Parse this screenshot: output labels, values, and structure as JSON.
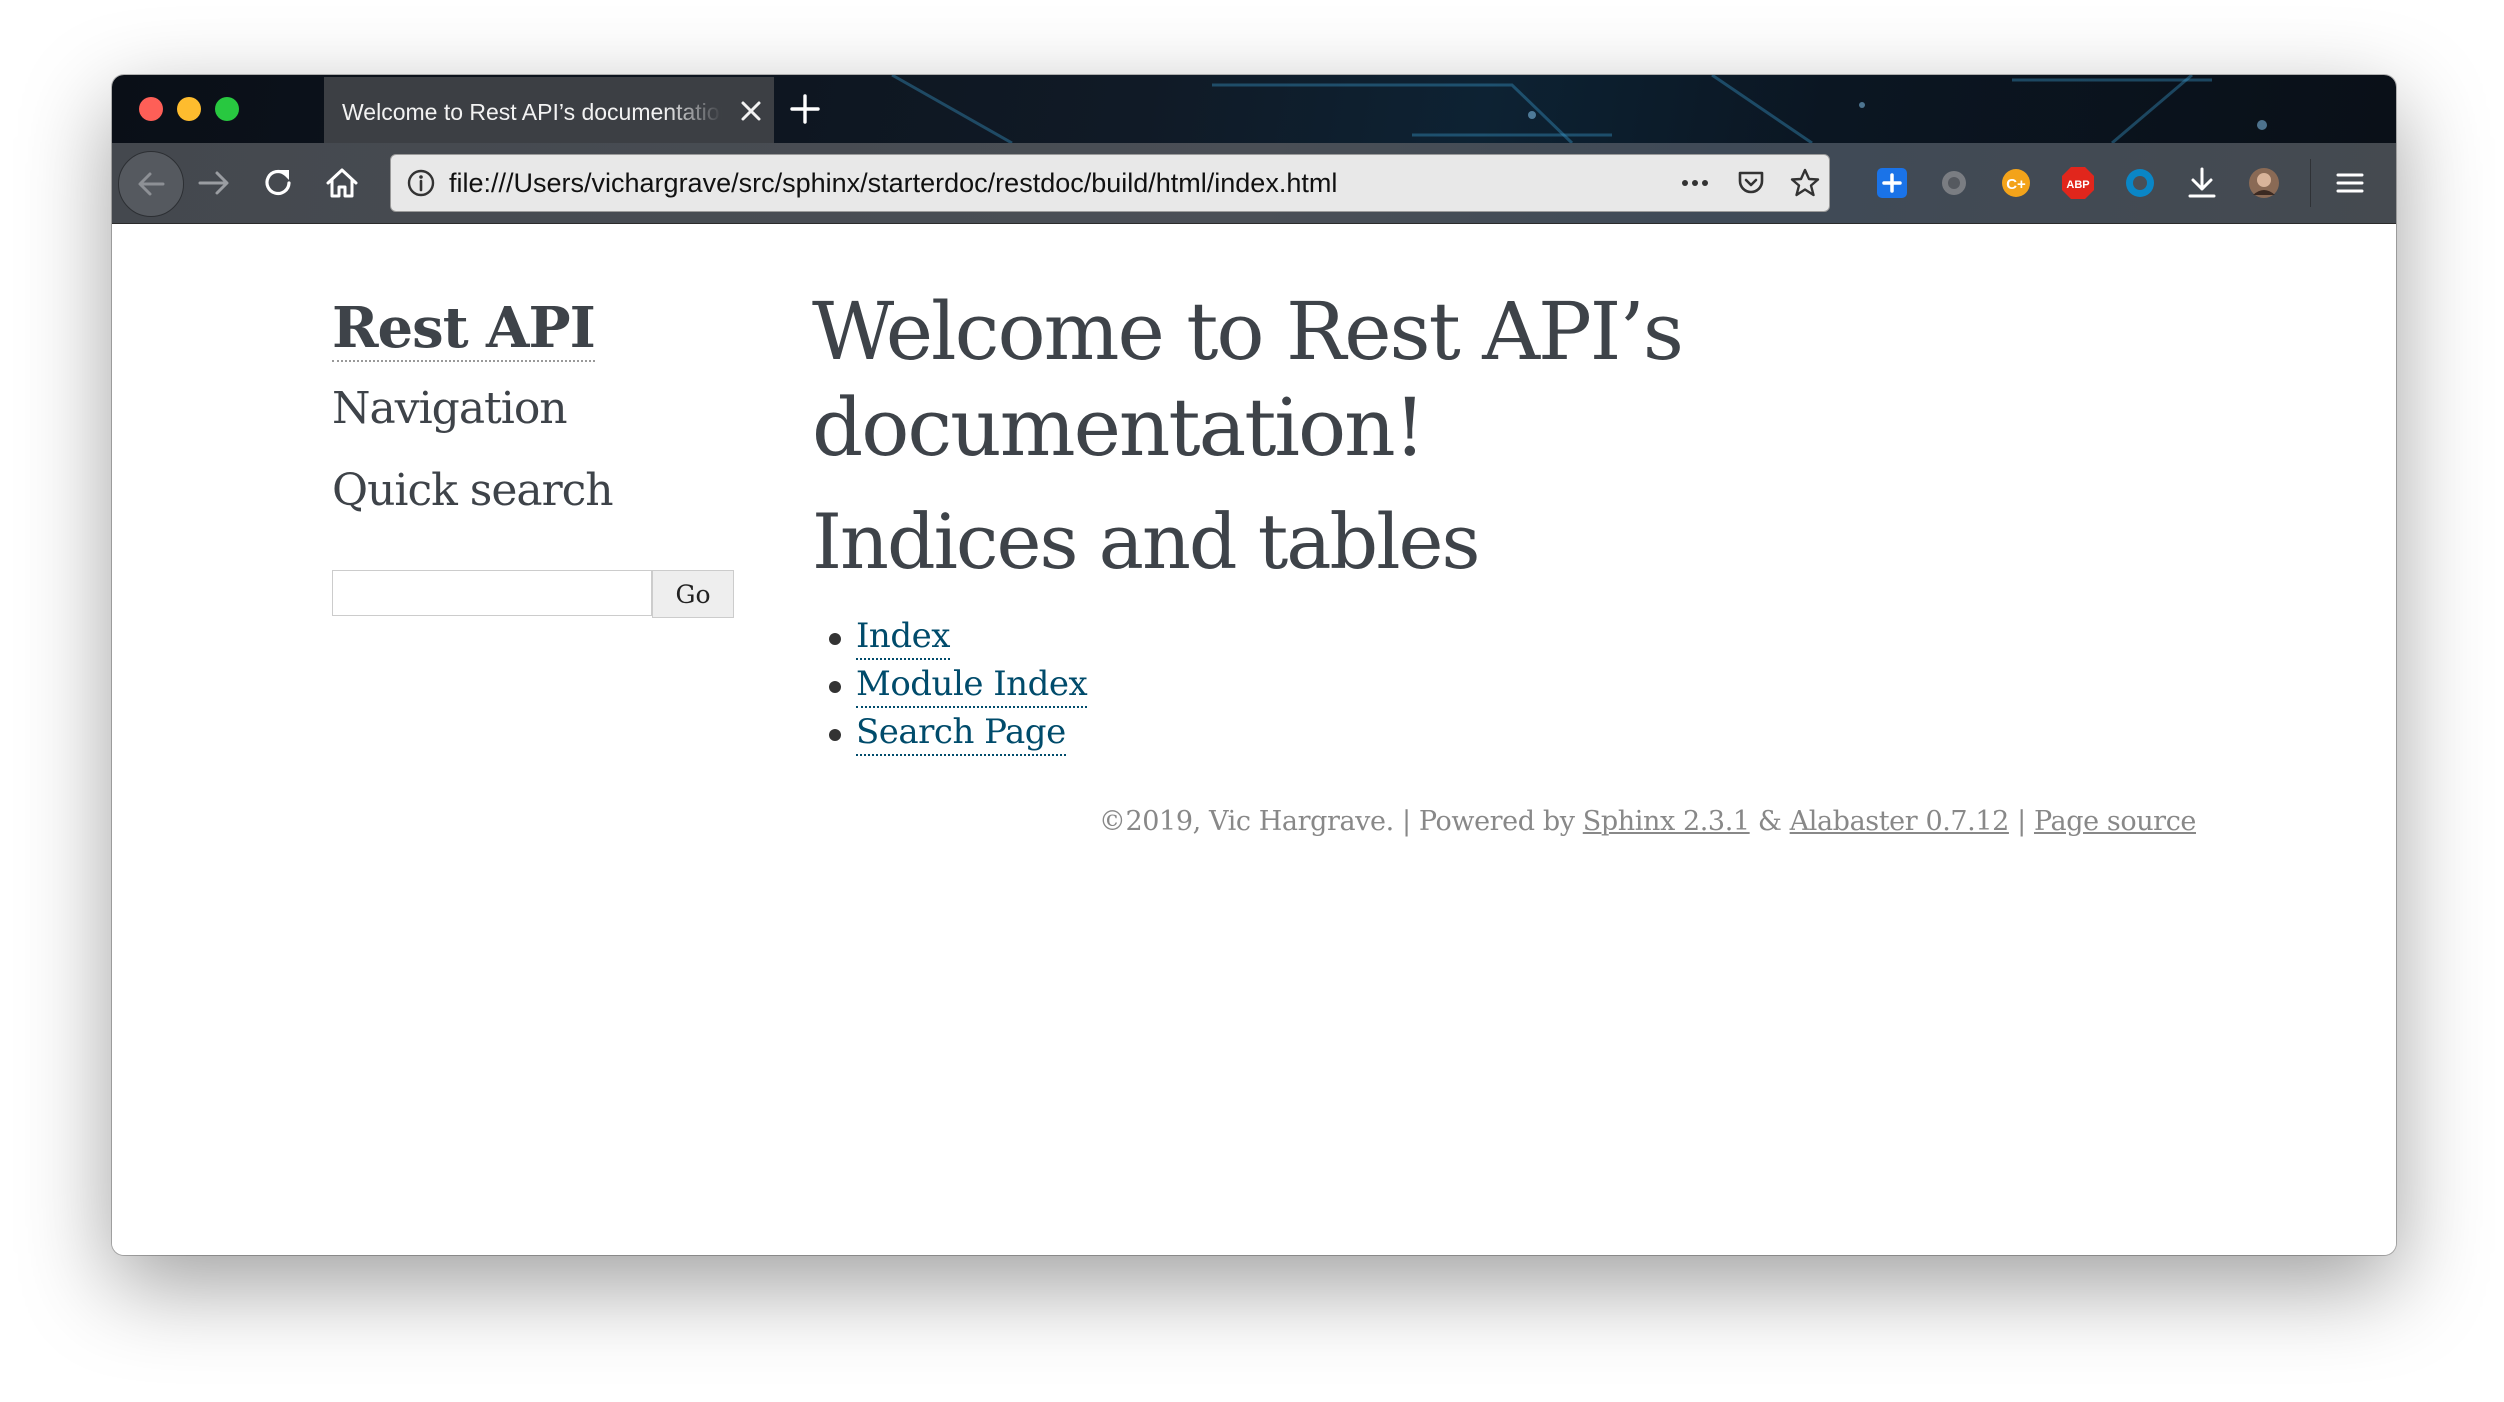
{
  "browser": {
    "tab_title": "Welcome to Rest API’s documentation!",
    "url": "file:///Users/vichargrave/src/sphinx/starterdoc/restdoc/build/html/index.html",
    "extensions": [
      "plus-icon",
      "ghost-icon",
      "cplus-icon",
      "ABP",
      "circle-icon",
      "download-icon",
      "avatar"
    ],
    "ext_abp_label": "ABP",
    "ext_c_label": "C+"
  },
  "sidebar": {
    "logo": "Rest API",
    "navigation_heading": "Navigation",
    "quick_search_heading": "Quick search",
    "search_placeholder": "",
    "go_label": "Go"
  },
  "main": {
    "title": "Welcome to Rest API’s documentation!",
    "section_heading": "Indices and tables",
    "links": [
      {
        "label": "Index"
      },
      {
        "label": "Module Index"
      },
      {
        "label": "Search Page"
      }
    ]
  },
  "footer": {
    "copyright": "©2019, Vic Hargrave.",
    "sep1": " | ",
    "powered_by": "Powered by ",
    "sphinx_link": "Sphinx 2.3.1",
    "amp": " & ",
    "alabaster_link": "Alabaster 0.7.12",
    "sep2": " | ",
    "page_source": "Page source"
  },
  "colors": {
    "link": "#004b6b",
    "text": "#3e4349",
    "footer": "#888888"
  }
}
